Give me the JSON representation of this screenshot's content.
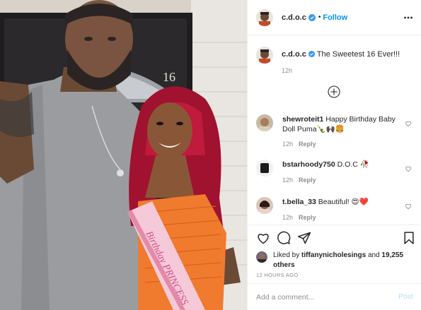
{
  "post": {
    "username": "c.d.o.c",
    "separator": "•",
    "follow_label": "Follow",
    "caption_text": "The Sweetest 16 Ever!!!",
    "caption_time": "12h"
  },
  "icons": {
    "verified": "verified-badge-icon",
    "more": "more-options-icon",
    "load_more": "load-more-comments-icon",
    "like": "heart-icon",
    "comment": "comment-icon",
    "share": "share-icon",
    "save": "bookmark-icon"
  },
  "comments": [
    {
      "username": "shewroteit1",
      "text": "Happy Birthday Baby Doll Puma🍾🙌🏿🍔",
      "time": "12h",
      "reply": "Reply"
    },
    {
      "username": "bstarhoody750",
      "text": "D.O.C 🥀",
      "time": "12h",
      "reply": "Reply"
    },
    {
      "username": "t.bella_33",
      "text": "Beautiful! 😍❤️",
      "time": "12h",
      "reply": "Reply"
    }
  ],
  "likes": {
    "prefix": "Liked by",
    "user": "tiffanynicholesings",
    "joiner": "and",
    "others": "19,255 others"
  },
  "timestamp": "12 HOURS AGO",
  "composer": {
    "placeholder": "Add a comment...",
    "post_label": "Post"
  },
  "photo": {
    "door_number": "16",
    "sash_text": "Birthday PRINCESS"
  },
  "colors": {
    "accent": "#0095f6",
    "post_disabled": "#b2dffc",
    "muted": "#8e8e8e",
    "heart_red": "#ed4956"
  }
}
